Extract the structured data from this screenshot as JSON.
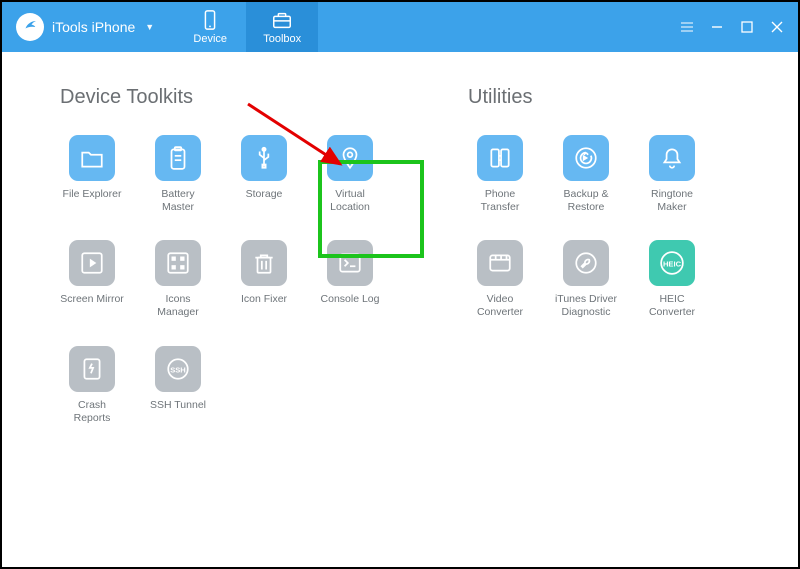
{
  "brand": {
    "name": "iTools iPhone"
  },
  "tabs": {
    "device": "Device",
    "toolbox": "Toolbox"
  },
  "sections": {
    "toolkits": "Device Toolkits",
    "utilities": "Utilities"
  },
  "toolkits": [
    {
      "id": "file-explorer",
      "label": "File Explorer",
      "color": "blue",
      "icon": "folder"
    },
    {
      "id": "battery-master",
      "label": "Battery Master",
      "color": "blue",
      "icon": "battery"
    },
    {
      "id": "storage",
      "label": "Storage",
      "color": "blue",
      "icon": "usb"
    },
    {
      "id": "virtual-location",
      "label": "Virtual Location",
      "color": "blue",
      "icon": "pin"
    },
    {
      "id": "screen-mirror",
      "label": "Screen Mirror",
      "color": "grey",
      "icon": "play"
    },
    {
      "id": "icons-manager",
      "label": "Icons Manager",
      "color": "grey",
      "icon": "gridicons"
    },
    {
      "id": "icon-fixer",
      "label": "Icon Fixer",
      "color": "grey",
      "icon": "trash"
    },
    {
      "id": "console-log",
      "label": "Console Log",
      "color": "grey",
      "icon": "console"
    },
    {
      "id": "crash-reports",
      "label": "Crash Reports",
      "color": "grey",
      "icon": "crash"
    },
    {
      "id": "ssh-tunnel",
      "label": "SSH Tunnel",
      "color": "grey",
      "icon": "ssh"
    }
  ],
  "utilities": [
    {
      "id": "phone-transfer",
      "label": "Phone Transfer",
      "color": "blue",
      "icon": "transfer"
    },
    {
      "id": "backup-restore",
      "label": "Backup & Restore",
      "color": "blue",
      "icon": "backup"
    },
    {
      "id": "ringtone-maker",
      "label": "Ringtone Maker",
      "color": "blue",
      "icon": "bell"
    },
    {
      "id": "video-converter",
      "label": "Video Converter",
      "color": "grey",
      "icon": "film"
    },
    {
      "id": "itunes-diag",
      "label": "iTunes Driver Diagnostic",
      "color": "grey",
      "icon": "wrench"
    },
    {
      "id": "heic-converter",
      "label": "HEIC Converter",
      "color": "teal",
      "icon": "heic"
    }
  ]
}
